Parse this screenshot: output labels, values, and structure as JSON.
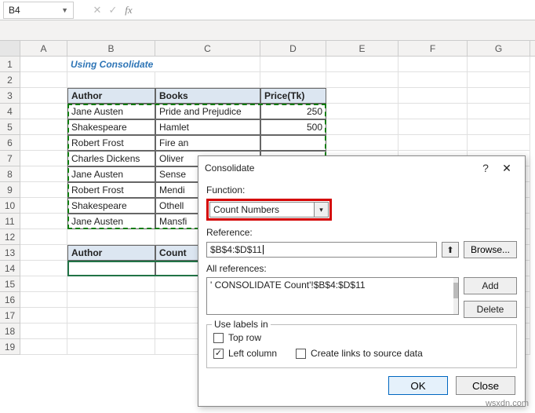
{
  "formula_bar": {
    "cell_ref": "B4",
    "fx_label": "fx",
    "value": ""
  },
  "columns": [
    "A",
    "B",
    "C",
    "D",
    "E",
    "F",
    "G"
  ],
  "col_widths": {
    "A": 60,
    "B": 112,
    "C": 134,
    "D": 84,
    "E": 92,
    "F": 88,
    "G": 80
  },
  "row_numbers": [
    1,
    2,
    3,
    4,
    5,
    6,
    7,
    8,
    9,
    10,
    11,
    12,
    13,
    14,
    15,
    16,
    17,
    18,
    19
  ],
  "title_text": "Using Consolidate Option",
  "table1": {
    "headers": [
      "Author",
      "Books",
      "Price(Tk)"
    ],
    "rows": [
      [
        "Jane Austen",
        "Pride and Prejudice",
        "250"
      ],
      [
        "Shakespeare",
        "Hamlet",
        "500"
      ],
      [
        "Robert Frost",
        "Fire an",
        ""
      ],
      [
        "Charles Dickens",
        "Oliver",
        ""
      ],
      [
        "Jane Austen",
        "Sense",
        ""
      ],
      [
        "Robert Frost",
        "Mendi",
        ""
      ],
      [
        "Shakespeare",
        "Othell",
        ""
      ],
      [
        "Jane Austen",
        "Mansfi",
        ""
      ]
    ]
  },
  "table2": {
    "headers": [
      "Author",
      "Count"
    ]
  },
  "dialog": {
    "title": "Consolidate",
    "labels": {
      "function": "Function:",
      "reference": "Reference:",
      "all_refs": "All references:",
      "use_labels": "Use labels in",
      "top_row": "Top row",
      "left_column": "Left column",
      "create_links": "Create links to source data"
    },
    "function_value": "Count Numbers",
    "reference_value": "$B$4:$D$11",
    "all_refs_items": [
      "' CONSOLIDATE Count'!$B$4:$D$11"
    ],
    "buttons": {
      "browse": "Browse...",
      "add": "Add",
      "delete": "Delete",
      "ok": "OK",
      "close": "Close"
    },
    "checks": {
      "top_row": false,
      "left_column": true,
      "create_links": false
    }
  },
  "watermark": "wsxdn.com",
  "chart_data": {
    "type": "table",
    "title": "Using Consolidate Option",
    "columns": [
      "Author",
      "Books",
      "Price(Tk)"
    ],
    "rows": [
      [
        "Jane Austen",
        "Pride and Prejudice",
        250
      ],
      [
        "Shakespeare",
        "Hamlet",
        500
      ],
      [
        "Robert Frost",
        "Fire an",
        null
      ],
      [
        "Charles Dickens",
        "Oliver",
        null
      ],
      [
        "Jane Austen",
        "Sense",
        null
      ],
      [
        "Robert Frost",
        "Mendi",
        null
      ],
      [
        "Shakespeare",
        "Othell",
        null
      ],
      [
        "Jane Austen",
        "Mansfi",
        null
      ]
    ]
  }
}
